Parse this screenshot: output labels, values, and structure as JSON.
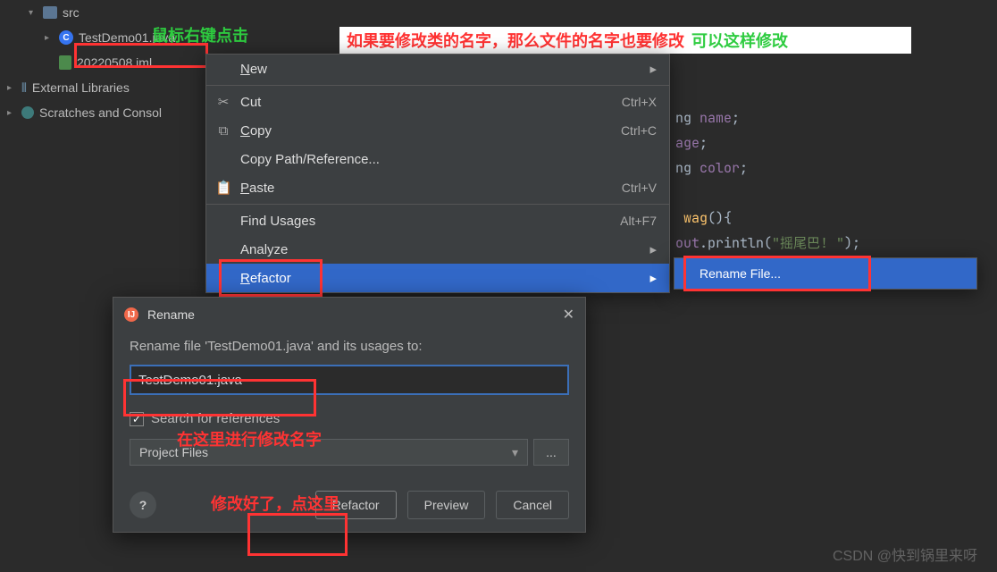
{
  "tree": {
    "src": "src",
    "file_java": "TestDemo01.java",
    "file_iml": "20220508.iml",
    "ext_lib": "External Libraries",
    "scratch": "Scratches and Consol"
  },
  "annotations": {
    "right_click": "鼠标右键点击",
    "top_red": "如果要修改类的名字，那么文件的名字也要修改",
    "top_green": "可以这样修改",
    "rename_here": "在这里进行修改名字",
    "done_click": "修改好了，点这里"
  },
  "ctx": {
    "new": "New",
    "cut": "Cut",
    "copy": "Copy",
    "copy_path": "Copy Path/Reference...",
    "paste": "Paste",
    "find_usages": "Find Usages",
    "analyze": "Analyze",
    "refactor": "Refactor",
    "sc_cut": "Ctrl+X",
    "sc_copy": "Ctrl+C",
    "sc_paste": "Ctrl+V",
    "sc_find": "Alt+F7"
  },
  "sub": {
    "rename_file": "Rename File..."
  },
  "code": {
    "l1_a": "ng ",
    "l1_b": "name",
    "l1_c": ";",
    "l2_a": "age",
    "l2_b": ";",
    "l3_a": "ng ",
    "l3_b": "color",
    "l3_c": ";",
    "l4_a": " wag",
    "l4_b": "(){",
    "l5_a": "out",
    "l5_b": ".println(",
    "l5_c": "\"摇尾巴! \"",
    "l5_d": ");"
  },
  "dlg": {
    "title": "Rename",
    "prompt": "Rename file 'TestDemo01.java' and its usages to:",
    "value": "TestDemo01.java",
    "chk_label": "Search for references",
    "scope": "Project Files",
    "scope_btn": "...",
    "btn_refactor": "Refactor",
    "btn_preview": "Preview",
    "btn_cancel": "Cancel",
    "help": "?"
  },
  "watermark": "CSDN @快到锅里来呀"
}
